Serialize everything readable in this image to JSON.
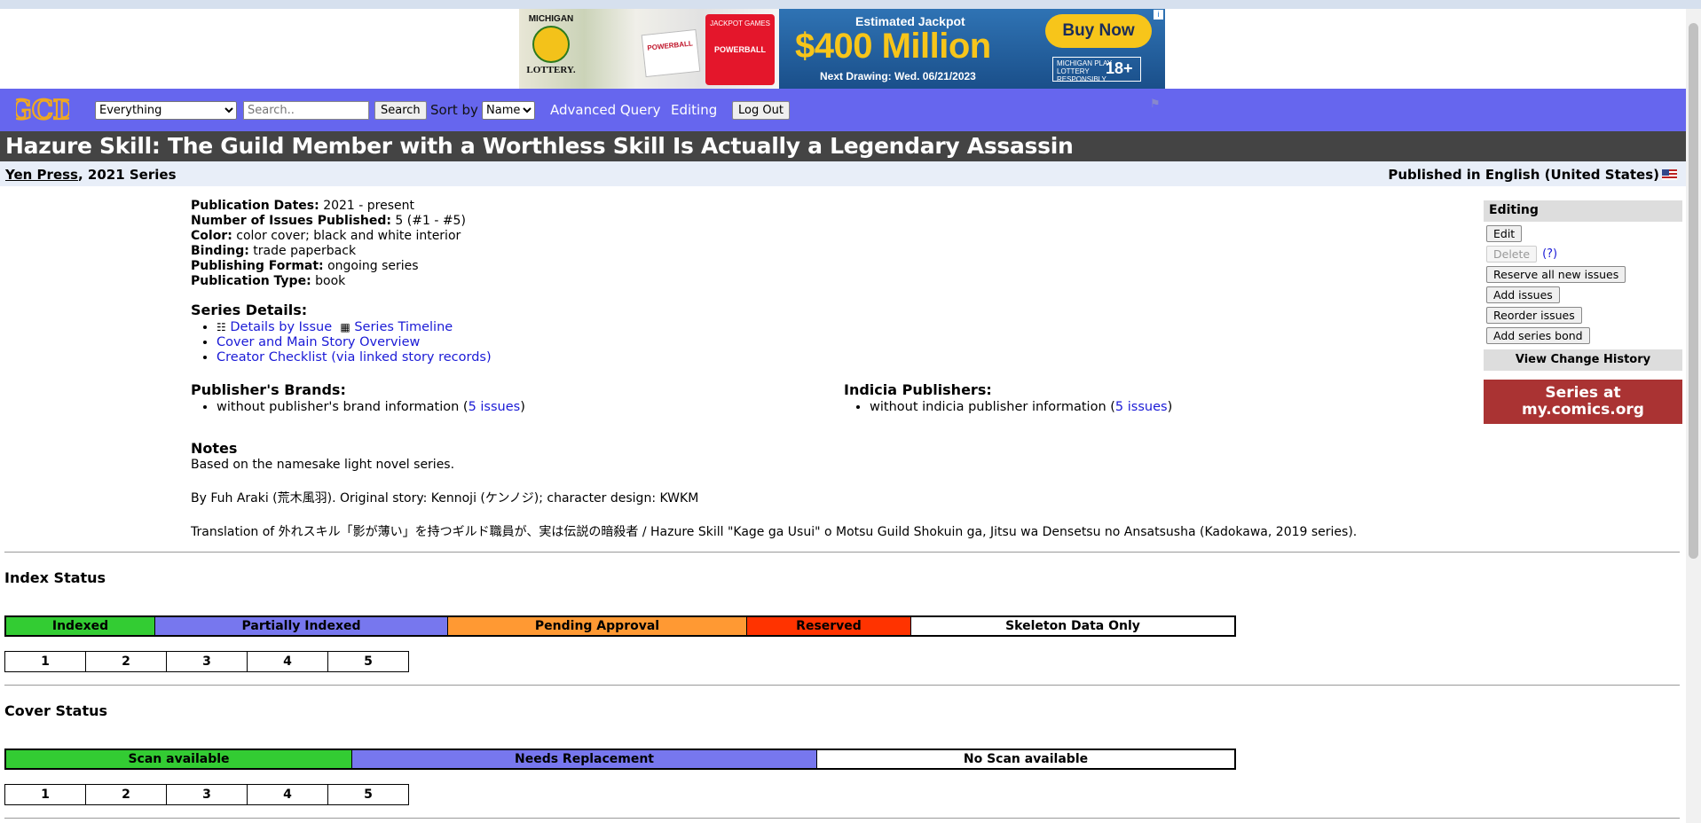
{
  "ad": {
    "brand_top": "MICHIGAN",
    "brand_bottom": "LOTTERY.",
    "ticket_text": "POWERBALL",
    "cards_text": "JACKPOT GAMES",
    "cards_sub": "POWERBALL",
    "estimated": "Estimated Jackpot",
    "amount": "$400 Million",
    "drawing": "Next Drawing: Wed. 06/21/2023",
    "buy_label": "Buy Now",
    "responsible": "MICHIGAN PLAY LOTTERY RESPONSIBLY",
    "age": "18+",
    "info": "i"
  },
  "nav": {
    "logo_text": "GCD",
    "search_scope": "Everything",
    "search_placeholder": "Search..",
    "search_button": "Search",
    "sort_label": "Sort by",
    "sort_value": "Name",
    "advanced_query": "Advanced Query",
    "editing": "Editing",
    "logout": "Log Out"
  },
  "series": {
    "title": "Hazure Skill: The Guild Member with a Worthless Skill Is Actually a Legendary Assassin",
    "publisher": "Yen Press",
    "year_series": ", 2021 Series",
    "published_in": "Published in English (United States)"
  },
  "details": {
    "publication_dates_label": "Publication Dates:",
    "publication_dates": "2021 - present",
    "issues_label": "Number of Issues Published:",
    "issues": "5 (#1 - #5)",
    "color_label": "Color:",
    "color": "color cover; black and white interior",
    "binding_label": "Binding:",
    "binding": "trade paperback",
    "format_label": "Publishing Format:",
    "format": "ongoing series",
    "type_label": "Publication Type:",
    "type": "book"
  },
  "series_details": {
    "heading": "Series Details:",
    "details_by_issue": "Details by Issue",
    "timeline": "Series Timeline",
    "cover_overview": "Cover and Main Story Overview",
    "creator_checklist": "Creator Checklist (via linked story records)"
  },
  "brands": {
    "heading": "Publisher's Brands:",
    "text": "without publisher's brand information (",
    "link": "5 issues",
    "close": ")"
  },
  "indicia": {
    "heading": "Indicia Publishers:",
    "text": "without indicia publisher information (",
    "link": "5 issues",
    "close": ")"
  },
  "notes": {
    "heading": "Notes",
    "line1": "Based on the namesake light novel series.",
    "line2": "By Fuh Araki (荒木風羽). Original story: Kennoji (ケンノジ); character design: KWKM",
    "line3": "Translation of 外れスキル「影が薄い」を持つギルド職員が、実は伝説の暗殺者 / Hazure Skill \"Kage ga Usui\" o Motsu Guild Shokuin ga, Jitsu wa Densetsu no Ansatsusha (Kadokawa, 2019 series)."
  },
  "sidebar": {
    "heading": "Editing",
    "edit": "Edit",
    "delete": "Delete",
    "help": "(?)",
    "reserve": "Reserve all new issues",
    "add_issues": "Add issues",
    "reorder": "Reorder issues",
    "add_bond": "Add series bond",
    "history": "View Change History",
    "mycomics_line1": "Series at",
    "mycomics_line2": "my.comics.org"
  },
  "index_status": {
    "heading": "Index Status",
    "legend": [
      {
        "label": "Indexed",
        "color": "#33cc33"
      },
      {
        "label": "Partially Indexed",
        "color": "#7777ee"
      },
      {
        "label": "Pending Approval",
        "color": "#ff9933"
      },
      {
        "label": "Reserved",
        "color": "#ff3300"
      },
      {
        "label": "Skeleton Data Only",
        "color": "#ffffff"
      }
    ],
    "issues": [
      "1",
      "2",
      "3",
      "4",
      "5"
    ]
  },
  "cover_status": {
    "heading": "Cover Status",
    "legend": [
      {
        "label": "Scan available",
        "color": "#33cc33"
      },
      {
        "label": "Needs Replacement",
        "color": "#7777ee"
      },
      {
        "label": "No Scan available",
        "color": "#ffffff"
      }
    ],
    "issues": [
      "1",
      "2",
      "3",
      "4",
      "5"
    ]
  }
}
